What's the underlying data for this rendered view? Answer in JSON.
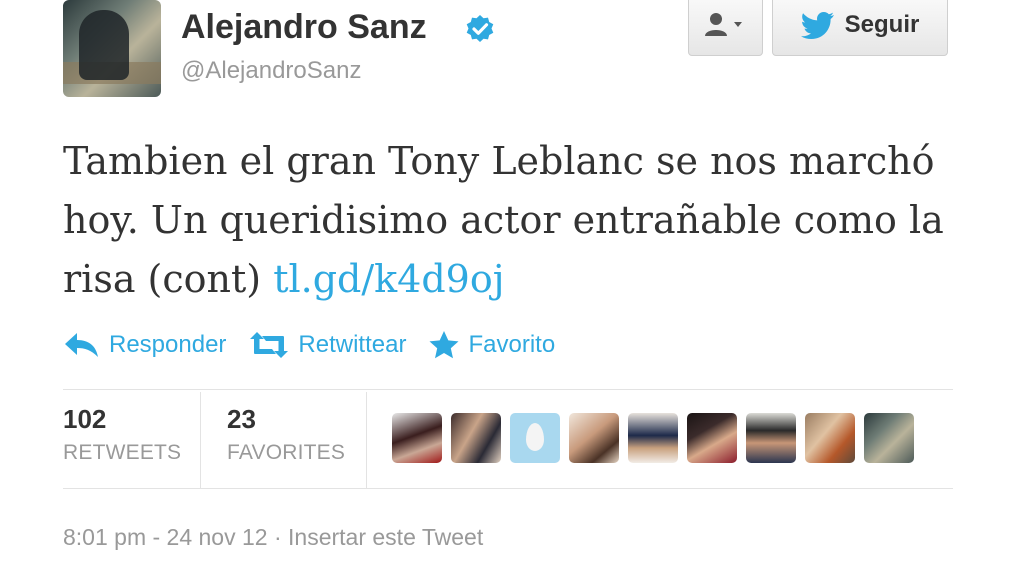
{
  "user": {
    "name": "Alejandro Sanz",
    "handle": "@AlejandroSanz",
    "verified_icon": "verified-check-icon"
  },
  "buttons": {
    "user_menu_icon": "user-dropdown-icon",
    "follow_label": "Seguir",
    "follow_icon": "twitter-bird-icon"
  },
  "tweet": {
    "text": "Tambien el gran Tony Leblanc se nos marchó hoy. Un queridisimo actor entrañable como la risa (cont) ",
    "link": "tl.gd/k4d9oj"
  },
  "actions": {
    "reply": "Responder",
    "retweet": "Retwittear",
    "favorite": "Favorito"
  },
  "stats": {
    "retweets_count": "102",
    "retweets_label": "RETWEETS",
    "favorites_count": "23",
    "favorites_label": "FAVORITES"
  },
  "footer": {
    "time": "8:01 pm - 24 nov 12",
    "separator": " · ",
    "embed": "Insertar este Tweet"
  },
  "colors": {
    "link": "#2fa9e0",
    "text": "#333333",
    "muted": "#999999"
  }
}
